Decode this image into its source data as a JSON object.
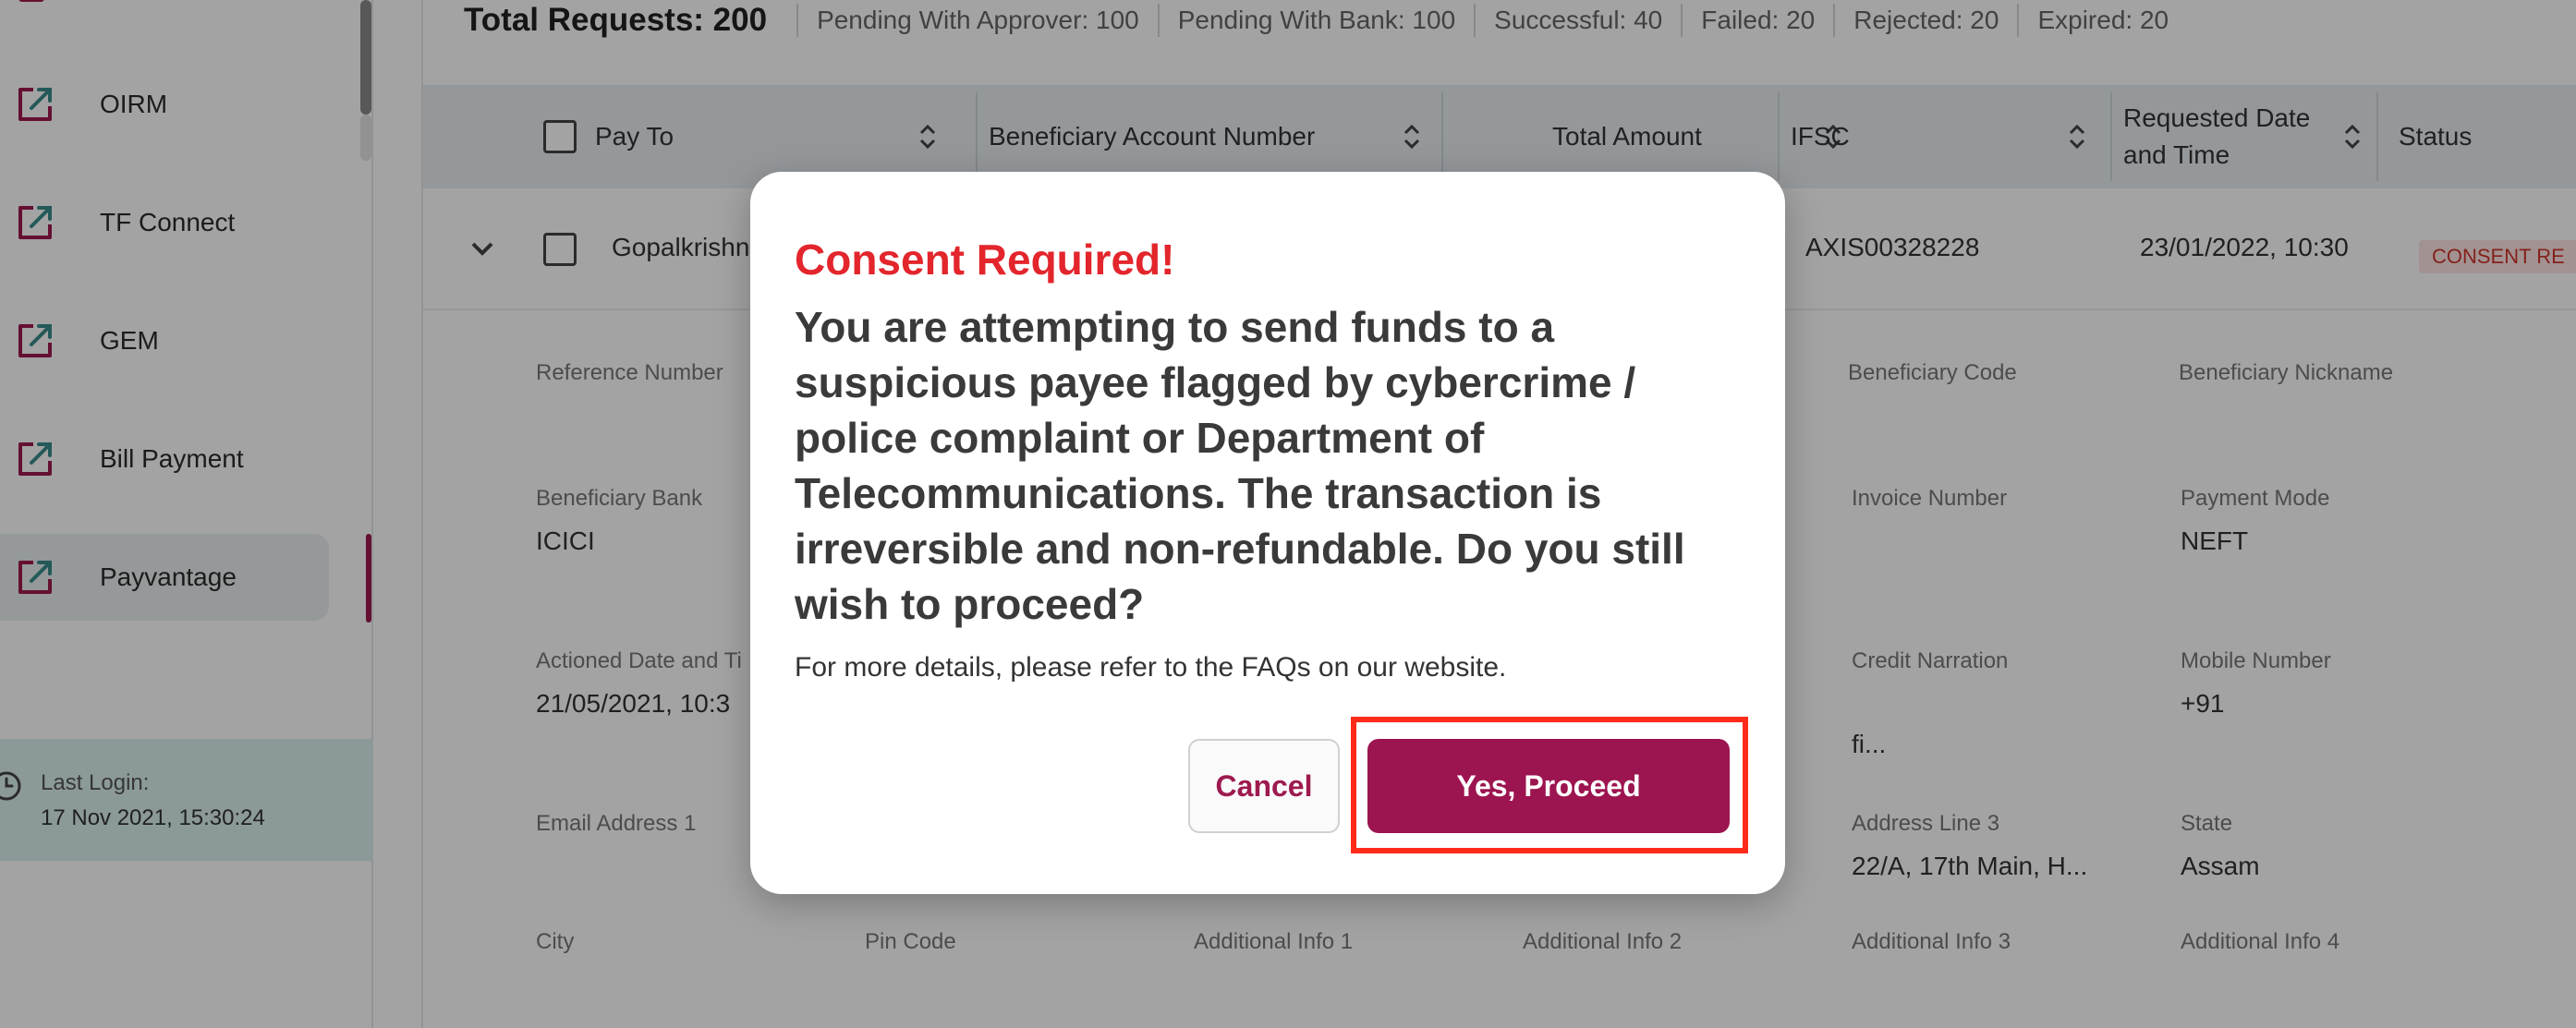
{
  "sidebar": {
    "items": [
      {
        "label": "OIRM",
        "icon": "external-link-icon"
      },
      {
        "label": "TF Connect",
        "icon": "external-link-icon"
      },
      {
        "label": "GEM",
        "icon": "external-link-icon"
      },
      {
        "label": "Bill Payment",
        "icon": "external-link-icon"
      },
      {
        "label": "Payvantage",
        "icon": "external-link-icon",
        "active": true
      }
    ],
    "last_login_label": "Last Login:",
    "last_login_value": "17 Nov 2021, 15:30:24"
  },
  "summary": {
    "total": "Total Requests: 200",
    "stats": [
      "Pending With Approver: 100",
      "Pending With Bank: 100",
      "Successful: 40",
      "Failed: 20",
      "Rejected: 20",
      "Expired: 20"
    ]
  },
  "table": {
    "headers": {
      "pay_to": "Pay To",
      "beneficiary_account": "Beneficiary Account Number",
      "total_amount": "Total Amount",
      "ifsc": "IFSC",
      "requested_line1": "Requested Date",
      "requested_line2": "and Time",
      "status": "Status"
    },
    "row": {
      "pay_to": "Gopalkrishn",
      "ifsc": "AXIS00328228",
      "requested": "23/01/2022, 10:30",
      "status": "CONSENT RE"
    },
    "details": {
      "reference_number_label": "Reference Number",
      "beneficiary_code_label": "Beneficiary Code",
      "beneficiary_nickname_label": "Beneficiary Nickname",
      "beneficiary_bank_label": "Beneficiary Bank",
      "beneficiary_bank_value": "ICICI",
      "invoice_number_label": "Invoice Number",
      "payment_mode_label": "Payment Mode",
      "payment_mode_value": "NEFT",
      "actioned_label": "Actioned Date and Ti",
      "actioned_value": "21/05/2021, 10:3",
      "credit_narration_label": "Credit Narration",
      "credit_narration_value": "fi...",
      "mobile_label": "Mobile Number",
      "mobile_value": "+91",
      "email_label": "Email Address 1",
      "address3_label": "Address Line 3",
      "address3_value": "22/A, 17th Main, H...",
      "state_label": "State",
      "state_value": "Assam",
      "city_label": "City",
      "pin_label": "Pin Code",
      "add1_label": "Additional Info 1",
      "add2_label": "Additional Info 2",
      "add3_label": "Additional Info 3",
      "add4_label": "Additional Info 4"
    }
  },
  "modal": {
    "title": "Consent Required!",
    "message": "You are attempting to send funds to a suspicious payee flagged by cybercrime / police complaint or Department of Telecommunications. The transaction is irreversible and non-refundable. Do you still wish to proceed?",
    "note": "For more details, please refer to the FAQs on our website.",
    "cancel_label": "Cancel",
    "proceed_label": "Yes, Proceed"
  },
  "colors": {
    "brand": "#9c1450",
    "alert_title": "#e3252c",
    "highlight": "#ff2a1a"
  }
}
